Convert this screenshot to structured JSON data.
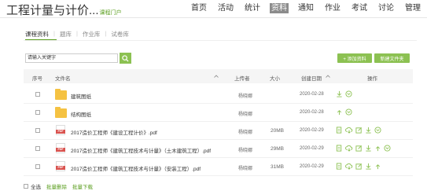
{
  "header": {
    "title": "工程计量与计价...",
    "portal_link": "课程门户",
    "nav": [
      "首页",
      "活动",
      "统计",
      "资料",
      "通知",
      "作业",
      "考试",
      "讨论",
      "管理"
    ],
    "active_nav": "资料"
  },
  "tabs": [
    "课程资料",
    "题库",
    "作业库",
    "试卷库"
  ],
  "search": {
    "placeholder": "请输入关键字"
  },
  "buttons": {
    "add": "+ 添加资料",
    "new_folder": "新建文件夹"
  },
  "table": {
    "headers": {
      "index": "序号",
      "name": "文件名",
      "uploader": "上传者",
      "size": "大小",
      "date": "创建日期",
      "ops": "操作"
    },
    "rows": [
      {
        "type": "folder",
        "name": "建筑图纸",
        "uploader": "杨晓娜",
        "size": "",
        "date": "2020-02-28"
      },
      {
        "type": "folder",
        "name": "结构图纸",
        "uploader": "杨晓娜",
        "size": "",
        "date": "2020-02-28"
      },
      {
        "type": "pdf",
        "name": "2017造价工程师《建设工程计价》.pdf",
        "uploader": "杨晓娜",
        "size": "20MB",
        "date": "2020-02-29"
      },
      {
        "type": "pdf",
        "name": "2017造价工程师《建筑工程技术与计量》（土木建筑工程）.pdf",
        "uploader": "杨晓娜",
        "size": "29MB",
        "date": "2020-02-29"
      },
      {
        "type": "pdf",
        "name": "2017造价工程师《建筑工程技术与计量》（安装工程）.pdf",
        "uploader": "杨晓娜",
        "size": "31MB",
        "date": "2020-02-29"
      }
    ]
  },
  "footer": {
    "select_all": "全选",
    "batch_delete": "批量删除",
    "batch_download": "批量下载"
  },
  "colors": {
    "accent": "#8cc152",
    "link": "#5a9e1e",
    "folder": "#f5c242",
    "pdf": "#d9534f"
  }
}
